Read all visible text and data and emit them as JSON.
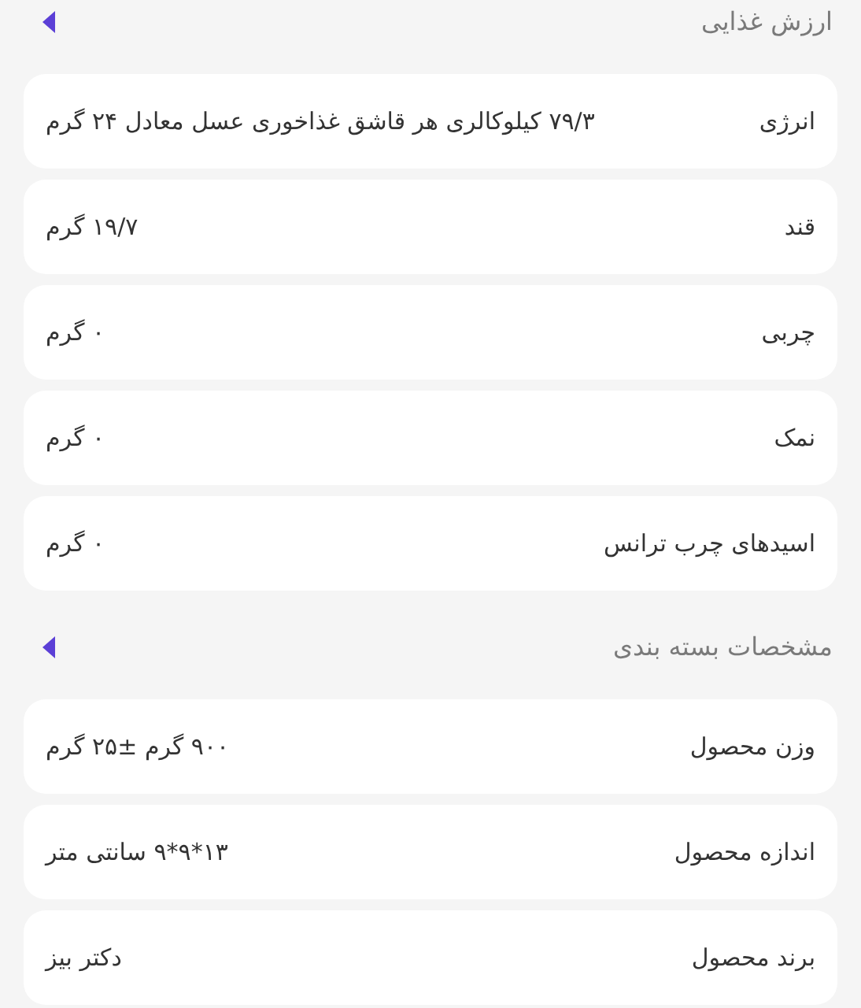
{
  "sections": [
    {
      "title": "ارزش غذایی",
      "rows": [
        {
          "label": "انرژی",
          "value": "۷۹/۳ کیلوکالری هر قاشق غذاخوری عسل معادل ۲۴ گرم"
        },
        {
          "label": "قند",
          "value": "۱۹/۷ گرم"
        },
        {
          "label": "چربی",
          "value": "۰ گرم"
        },
        {
          "label": "نمک",
          "value": "۰ گرم"
        },
        {
          "label": "اسیدهای چرب ترانس",
          "value": "۰ گرم"
        }
      ]
    },
    {
      "title": "مشخصات بسته بندی",
      "rows": [
        {
          "label": "وزن محصول",
          "value": "۹۰۰ گرم ±۲۵ گرم"
        },
        {
          "label": "اندازه محصول",
          "value": "۱۳*۹*۹ سانتی متر"
        },
        {
          "label": "برند محصول",
          "value": "دکتر بیز"
        }
      ]
    }
  ]
}
